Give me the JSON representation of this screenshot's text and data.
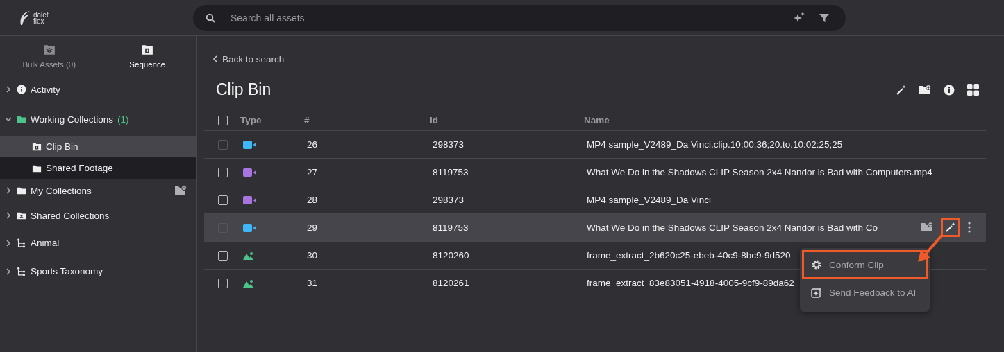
{
  "logo": {
    "line_1": "dalet",
    "line_2": "flex"
  },
  "search": {
    "placeholder": "Search all assets"
  },
  "sidebar": {
    "tabs": [
      {
        "label": "Bulk Assets (0)",
        "selected": false,
        "kind": "layers"
      },
      {
        "label": "Sequence",
        "selected": true,
        "kind": "film"
      }
    ],
    "items": [
      {
        "label": "Activity",
        "kind": "info",
        "expanded": false
      },
      {
        "label": "Working Collections",
        "count": "(1)",
        "kind": "working",
        "expanded": true,
        "children": [
          {
            "label": "Clip Bin",
            "kind": "film",
            "selected": true
          },
          {
            "label": "Shared Footage",
            "kind": "folder",
            "selected": false
          }
        ]
      },
      {
        "label": "My Collections",
        "kind": "folder",
        "expanded": false,
        "action": true
      },
      {
        "label": "Shared Collections",
        "kind": "shared",
        "expanded": false
      },
      {
        "label": "Animal",
        "kind": "taxonomy",
        "expanded": false
      },
      {
        "label": "Sports Taxonomy",
        "kind": "taxonomy",
        "expanded": false
      }
    ]
  },
  "back_link": "Back to search",
  "title": "Clip Bin",
  "table": {
    "select_all": {
      "checked": false
    },
    "columns": [
      "Type",
      "#",
      "Id",
      "Name"
    ],
    "rows": [
      {
        "kind": "video",
        "color": "#3fb6f7",
        "number": "26",
        "id": "298373",
        "name": "MP4 sample_V2489_Da Vinci.clip.10:00:36;20.to.10:02:25;25",
        "disabled": true,
        "highlighted": false
      },
      {
        "kind": "video",
        "color": "#a875e0",
        "number": "27",
        "id": "8119753",
        "name": "What We Do in the Shadows CLIP Season 2x4 Nandor is Bad with Computers.mp4",
        "disabled": false,
        "highlighted": false
      },
      {
        "kind": "video",
        "color": "#a875e0",
        "number": "28",
        "id": "298373",
        "name": "MP4 sample_V2489_Da Vinci",
        "disabled": false,
        "highlighted": false
      },
      {
        "kind": "video",
        "color": "#3fb6f7",
        "number": "29",
        "id": "8119753",
        "name": "What We Do in the Shadows CLIP Season 2x4 Nandor is Bad with Co",
        "disabled": true,
        "highlighted": true
      },
      {
        "kind": "image",
        "color": "#4cc38a",
        "number": "30",
        "id": "8120260",
        "name": "frame_extract_2b620c25-ebeb-40c9-8bc9-9d520",
        "disabled": false,
        "highlighted": false
      },
      {
        "kind": "image",
        "color": "#4cc38a",
        "number": "31",
        "id": "8120261",
        "name": "frame_extract_83e83051-4918-4005-9cf9-89da62",
        "disabled": false,
        "highlighted": false
      }
    ]
  },
  "menu": {
    "items": [
      {
        "label": "Conform Clip",
        "kind": "gear",
        "selected": true
      },
      {
        "label": "Send Feedback to AI",
        "kind": "sparkle",
        "selected": false
      }
    ]
  }
}
